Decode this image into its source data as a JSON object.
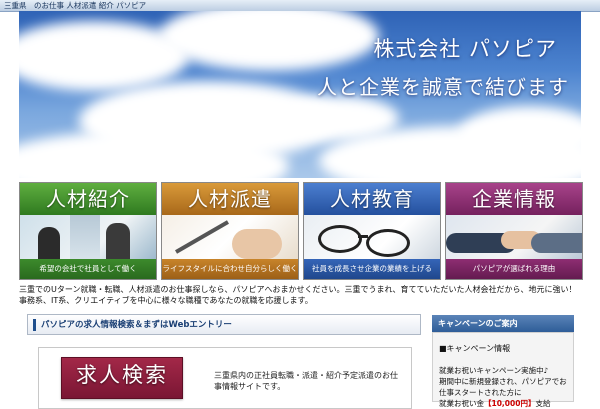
{
  "header": {
    "breadcrumb": "三重県　のお仕事 人材派遣 紹介 パソピア"
  },
  "hero": {
    "company": "株式会社 パソピア",
    "slogan": "人と企業を誠意で結びます"
  },
  "tiles": [
    {
      "title": "人材紹介",
      "caption": "希望の会社で社員として働く",
      "color": "#3c8a2c"
    },
    {
      "title": "人材派遣",
      "caption": "ライフスタイルに合わせ自分らしく働く",
      "color": "#b8791f"
    },
    {
      "title": "人材教育",
      "caption": "社員を成長させ企業の業績を上げる",
      "color": "#2f5fb3"
    },
    {
      "title": "企業情報",
      "caption": "パソピアが選ばれる理由",
      "color": "#8a2d6e"
    }
  ],
  "intro": "三重でのUターン就職・転職、人材派遣のお仕事探しなら、パソピアへおまかせください。三重でうまれ、育てていただいた人材会社だから、地元に強い！事務系、IT系、クリエイティブを中心に様々な職種であなたの就職を応援します。",
  "main": {
    "section_title": "パソピアの求人情報検索＆まずはWebエントリー",
    "search_banner": "求人検索",
    "search_desc": "三重県内の正社員転職・派遣・紹介予定派遣のお仕事情報サイトです。"
  },
  "sidebar": {
    "heading": "キャンペーンのご案内",
    "campaign_title": "■キャンペーン情報",
    "campaign_text_1": "就業お祝いキャンペーン実施中♪",
    "campaign_text_2": "期間中に新規登録され、パソピアでお仕事スタートされた方に",
    "campaign_text_3": "就業お祝い金",
    "campaign_amount": "【10,000円】",
    "campaign_text_4": "支給"
  },
  "colors": {
    "accent": "#1f4e8c",
    "sidebar_header": "#2e5d98",
    "search_banner": "#8a1c3c",
    "highlight": "#cc0000"
  }
}
